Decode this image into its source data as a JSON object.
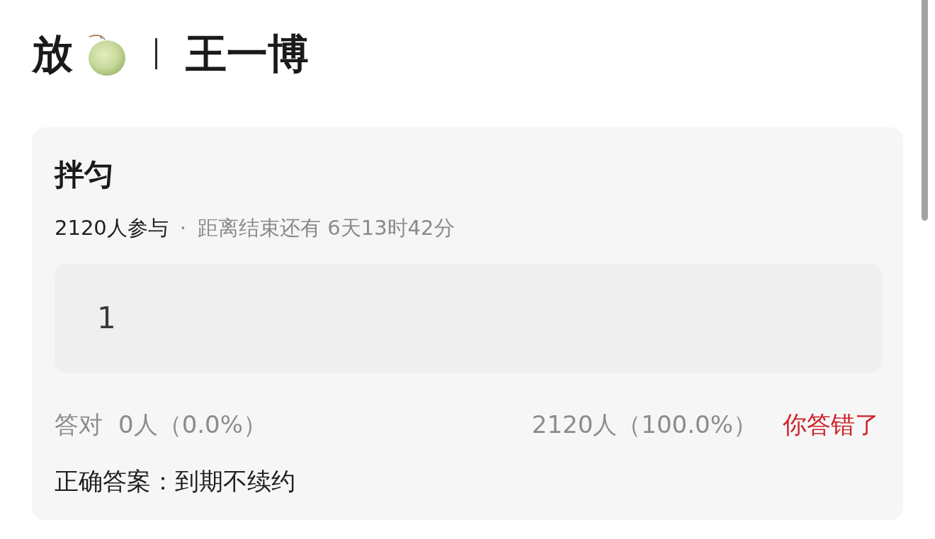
{
  "header": {
    "title_start": "放",
    "title_end": "王一博"
  },
  "quiz": {
    "title": "拌匀",
    "participants": "2120人参与",
    "separator": "·",
    "countdown": "距离结束还有 6天13时42分",
    "answer": "1",
    "stats": {
      "correct_label": "答对",
      "correct_count": "0人（0.0%）",
      "wrong_count": "2120人（100.0%）",
      "result": {
        "text": "你答错了",
        "correct": false
      }
    },
    "solution": "正确答案：到期不续约"
  }
}
